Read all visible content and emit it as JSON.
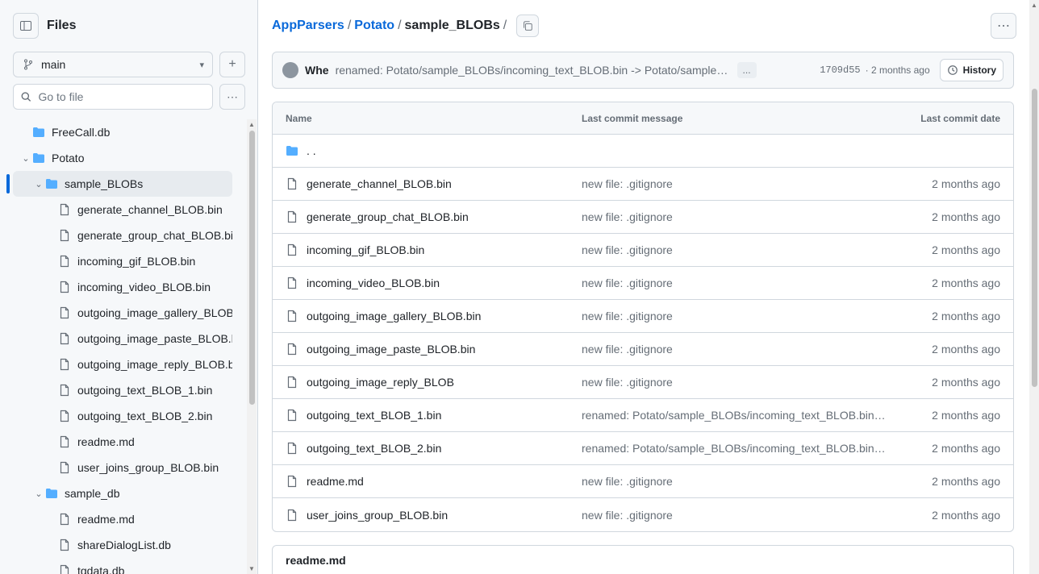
{
  "sidebar": {
    "title": "Files",
    "branch": "main",
    "search_placeholder": "Go to file",
    "tree": [
      {
        "label": "FreeCall.db",
        "kind": "folder",
        "depth": 0,
        "expanded": false,
        "name": "tree-item-freecall-db"
      },
      {
        "label": "Potato",
        "kind": "folder",
        "depth": 0,
        "expanded": true,
        "name": "tree-item-potato"
      },
      {
        "label": "sample_BLOBs",
        "kind": "folder",
        "depth": 1,
        "expanded": true,
        "selected": true,
        "name": "tree-item-sample-blobs"
      },
      {
        "label": "generate_channel_BLOB.bin",
        "kind": "file",
        "depth": 2,
        "name": "tree-item-generate-channel-blob"
      },
      {
        "label": "generate_group_chat_BLOB.bin",
        "kind": "file",
        "depth": 2,
        "name": "tree-item-generate-group-chat-blob"
      },
      {
        "label": "incoming_gif_BLOB.bin",
        "kind": "file",
        "depth": 2,
        "name": "tree-item-incoming-gif-blob"
      },
      {
        "label": "incoming_video_BLOB.bin",
        "kind": "file",
        "depth": 2,
        "name": "tree-item-incoming-video-blob"
      },
      {
        "label": "outgoing_image_gallery_BLOB.bin",
        "kind": "file",
        "depth": 2,
        "name": "tree-item-outgoing-image-gallery-blob"
      },
      {
        "label": "outgoing_image_paste_BLOB.bin",
        "kind": "file",
        "depth": 2,
        "name": "tree-item-outgoing-image-paste-blob"
      },
      {
        "label": "outgoing_image_reply_BLOB.bin",
        "kind": "file",
        "depth": 2,
        "name": "tree-item-outgoing-image-reply-blob"
      },
      {
        "label": "outgoing_text_BLOB_1.bin",
        "kind": "file",
        "depth": 2,
        "name": "tree-item-outgoing-text-blob-1"
      },
      {
        "label": "outgoing_text_BLOB_2.bin",
        "kind": "file",
        "depth": 2,
        "name": "tree-item-outgoing-text-blob-2"
      },
      {
        "label": "readme.md",
        "kind": "file",
        "depth": 2,
        "name": "tree-item-readme-md"
      },
      {
        "label": "user_joins_group_BLOB.bin",
        "kind": "file",
        "depth": 2,
        "name": "tree-item-user-joins-group-blob"
      },
      {
        "label": "sample_db",
        "kind": "folder",
        "depth": 1,
        "expanded": true,
        "name": "tree-item-sample-db"
      },
      {
        "label": "readme.md",
        "kind": "file",
        "depth": 2,
        "name": "tree-item-sample-db-readme"
      },
      {
        "label": "shareDialogList.db",
        "kind": "file",
        "depth": 2,
        "name": "tree-item-share-dialog-list-db"
      },
      {
        "label": "tgdata.db",
        "kind": "file",
        "depth": 2,
        "name": "tree-item-tgdata-db"
      }
    ]
  },
  "breadcrumb": {
    "root": "AppParsers",
    "folder": "Potato",
    "current": "sample_BLOBs",
    "sep": "/"
  },
  "commit": {
    "author": "Whe",
    "message": "renamed: Potato/sample_BLOBs/incoming_text_BLOB.bin -> Potato/sample_BLOBs/...",
    "ellipsis": "...",
    "sha": "1709d55",
    "time": "· 2 months ago",
    "history_label": "History"
  },
  "table": {
    "headers": {
      "name": "Name",
      "message": "Last commit message",
      "date": "Last commit date"
    },
    "parent_label": ". .",
    "rows": [
      {
        "name": "generate_channel_BLOB.bin",
        "message": "new file: .gitignore",
        "date": "2 months ago"
      },
      {
        "name": "generate_group_chat_BLOB.bin",
        "message": "new file: .gitignore",
        "date": "2 months ago"
      },
      {
        "name": "incoming_gif_BLOB.bin",
        "message": "new file: .gitignore",
        "date": "2 months ago"
      },
      {
        "name": "incoming_video_BLOB.bin",
        "message": "new file: .gitignore",
        "date": "2 months ago"
      },
      {
        "name": "outgoing_image_gallery_BLOB.bin",
        "message": "new file: .gitignore",
        "date": "2 months ago"
      },
      {
        "name": "outgoing_image_paste_BLOB.bin",
        "message": "new file: .gitignore",
        "date": "2 months ago"
      },
      {
        "name": "outgoing_image_reply_BLOB",
        "message": "new file: .gitignore",
        "date": "2 months ago"
      },
      {
        "name": "outgoing_text_BLOB_1.bin",
        "message": "renamed: Potato/sample_BLOBs/incoming_text_BLOB.bin -> ...",
        "date": "2 months ago"
      },
      {
        "name": "outgoing_text_BLOB_2.bin",
        "message": "renamed: Potato/sample_BLOBs/incoming_text_BLOB.bin -> ...",
        "date": "2 months ago"
      },
      {
        "name": "readme.md",
        "message": "new file: .gitignore",
        "date": "2 months ago"
      },
      {
        "name": "user_joins_group_BLOB.bin",
        "message": "new file: .gitignore",
        "date": "2 months ago"
      }
    ]
  },
  "readme": {
    "title": "readme.md"
  },
  "icons": {
    "sidebar_toggle": "sidebar-collapse-icon",
    "branch": "git-branch-icon",
    "search": "search-icon",
    "folder": "folder-icon",
    "file": "file-icon",
    "history": "history-icon",
    "copy": "copy-icon",
    "more": "kebab-icon"
  },
  "colors": {
    "folder": "#54aeff",
    "link": "#0969da",
    "accent": "#0969da"
  }
}
